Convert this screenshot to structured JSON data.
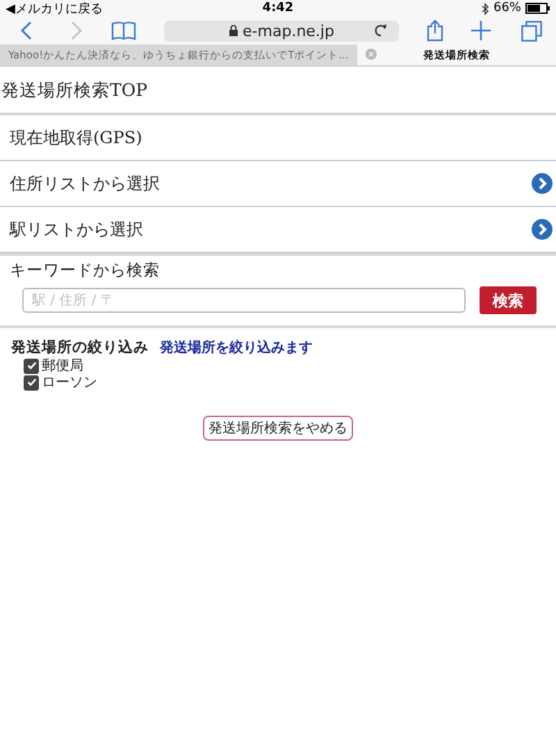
{
  "status_bar": {
    "back_app": "◀メルカリに戻る",
    "time": "4:42",
    "battery": "66%"
  },
  "address_bar": {
    "url": "e-map.ne.jp"
  },
  "tabs": [
    {
      "label": "Yahoo!かんたん決済なら、ゆうちょ銀行からの支払いでTポイント...",
      "selected": false
    },
    {
      "label": "発送場所検索",
      "selected": true
    }
  ],
  "page": {
    "title": "発送場所検索TOP",
    "menu": [
      {
        "label": "現在地取得(GPS)",
        "arrow": false
      },
      {
        "label": "住所リストから選択",
        "arrow": true
      },
      {
        "label": "駅リストから選択",
        "arrow": true
      }
    ],
    "keyword": {
      "heading": "キーワードから検索",
      "placeholder": "駅 / 住所 / 〒",
      "button": "検索"
    },
    "filter": {
      "heading": "発送場所の絞り込み",
      "link": "発送場所を絞り込みます",
      "options": [
        {
          "label": "郵便局",
          "checked": true
        },
        {
          "label": "ローソン",
          "checked": true
        }
      ]
    },
    "cancel_button": "発送場所検索をやめる"
  }
}
